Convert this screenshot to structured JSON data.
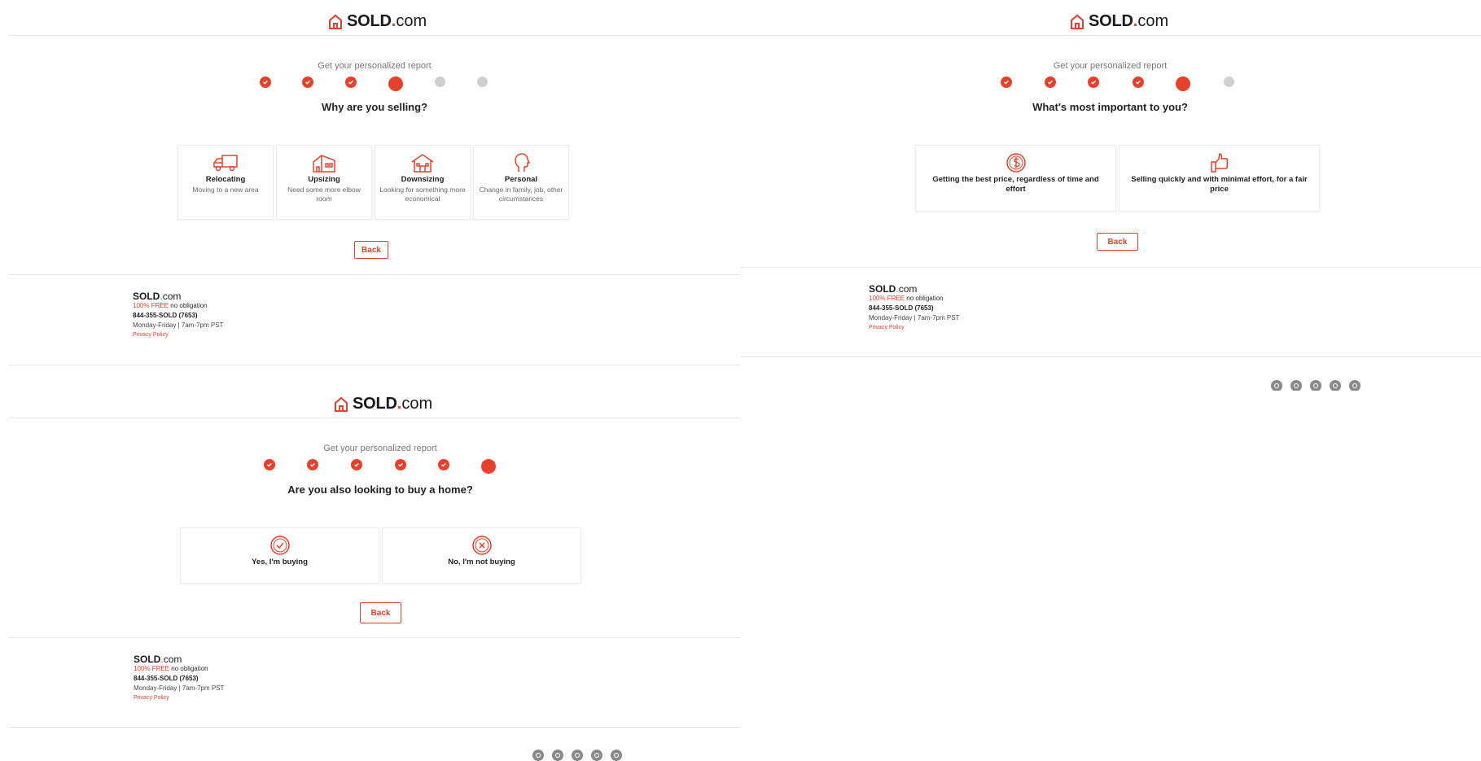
{
  "brand": {
    "name_bold": "SOLD",
    "dot": ".",
    "tld": "com",
    "accent": "#e8412b"
  },
  "subtitle": "Get your personalized report",
  "back_label": "Back",
  "footer": {
    "free": "100% FREE",
    "no_obligation": " no obligation",
    "phone": "844-355-SOLD (7653)",
    "hours": "Monday-Friday | 7am-7pm PST",
    "privacy": "Privacy Policy"
  },
  "social_icons": [
    "facebook-icon",
    "twitter-icon",
    "instagram-icon",
    "youtube-icon",
    "pinterest-icon"
  ],
  "panels": {
    "selling_reason": {
      "steps": [
        "done",
        "done",
        "done",
        "current",
        "todo",
        "todo"
      ],
      "question": "Why are you selling?",
      "options": [
        {
          "icon": "truck-icon",
          "title": "Relocating",
          "desc": "Moving to a new area"
        },
        {
          "icon": "larger-house-icon",
          "title": "Upsizing",
          "desc": "Need some more elbow room"
        },
        {
          "icon": "small-house-icon",
          "title": "Downsizing",
          "desc": "Looking for something more economical"
        },
        {
          "icon": "head-profile-icon",
          "title": "Personal",
          "desc": "Change in family, job, other circumstances"
        }
      ]
    },
    "priority": {
      "steps": [
        "done",
        "done",
        "done",
        "done",
        "current",
        "todo"
      ],
      "question": "What's most important to you?",
      "options": [
        {
          "icon": "dollar-coin-icon",
          "title": "Getting the best price, regardless of time and effort"
        },
        {
          "icon": "thumbs-up-icon",
          "title": "Selling quickly and with minimal effort, for a fair price"
        }
      ]
    },
    "buying": {
      "steps": [
        "done",
        "done",
        "done",
        "done",
        "done",
        "current"
      ],
      "question": "Are you also looking to buy a home?",
      "options": [
        {
          "icon": "check-circle-icon",
          "title": "Yes, I'm buying"
        },
        {
          "icon": "x-circle-icon",
          "title": "No, I'm not buying"
        }
      ]
    }
  }
}
